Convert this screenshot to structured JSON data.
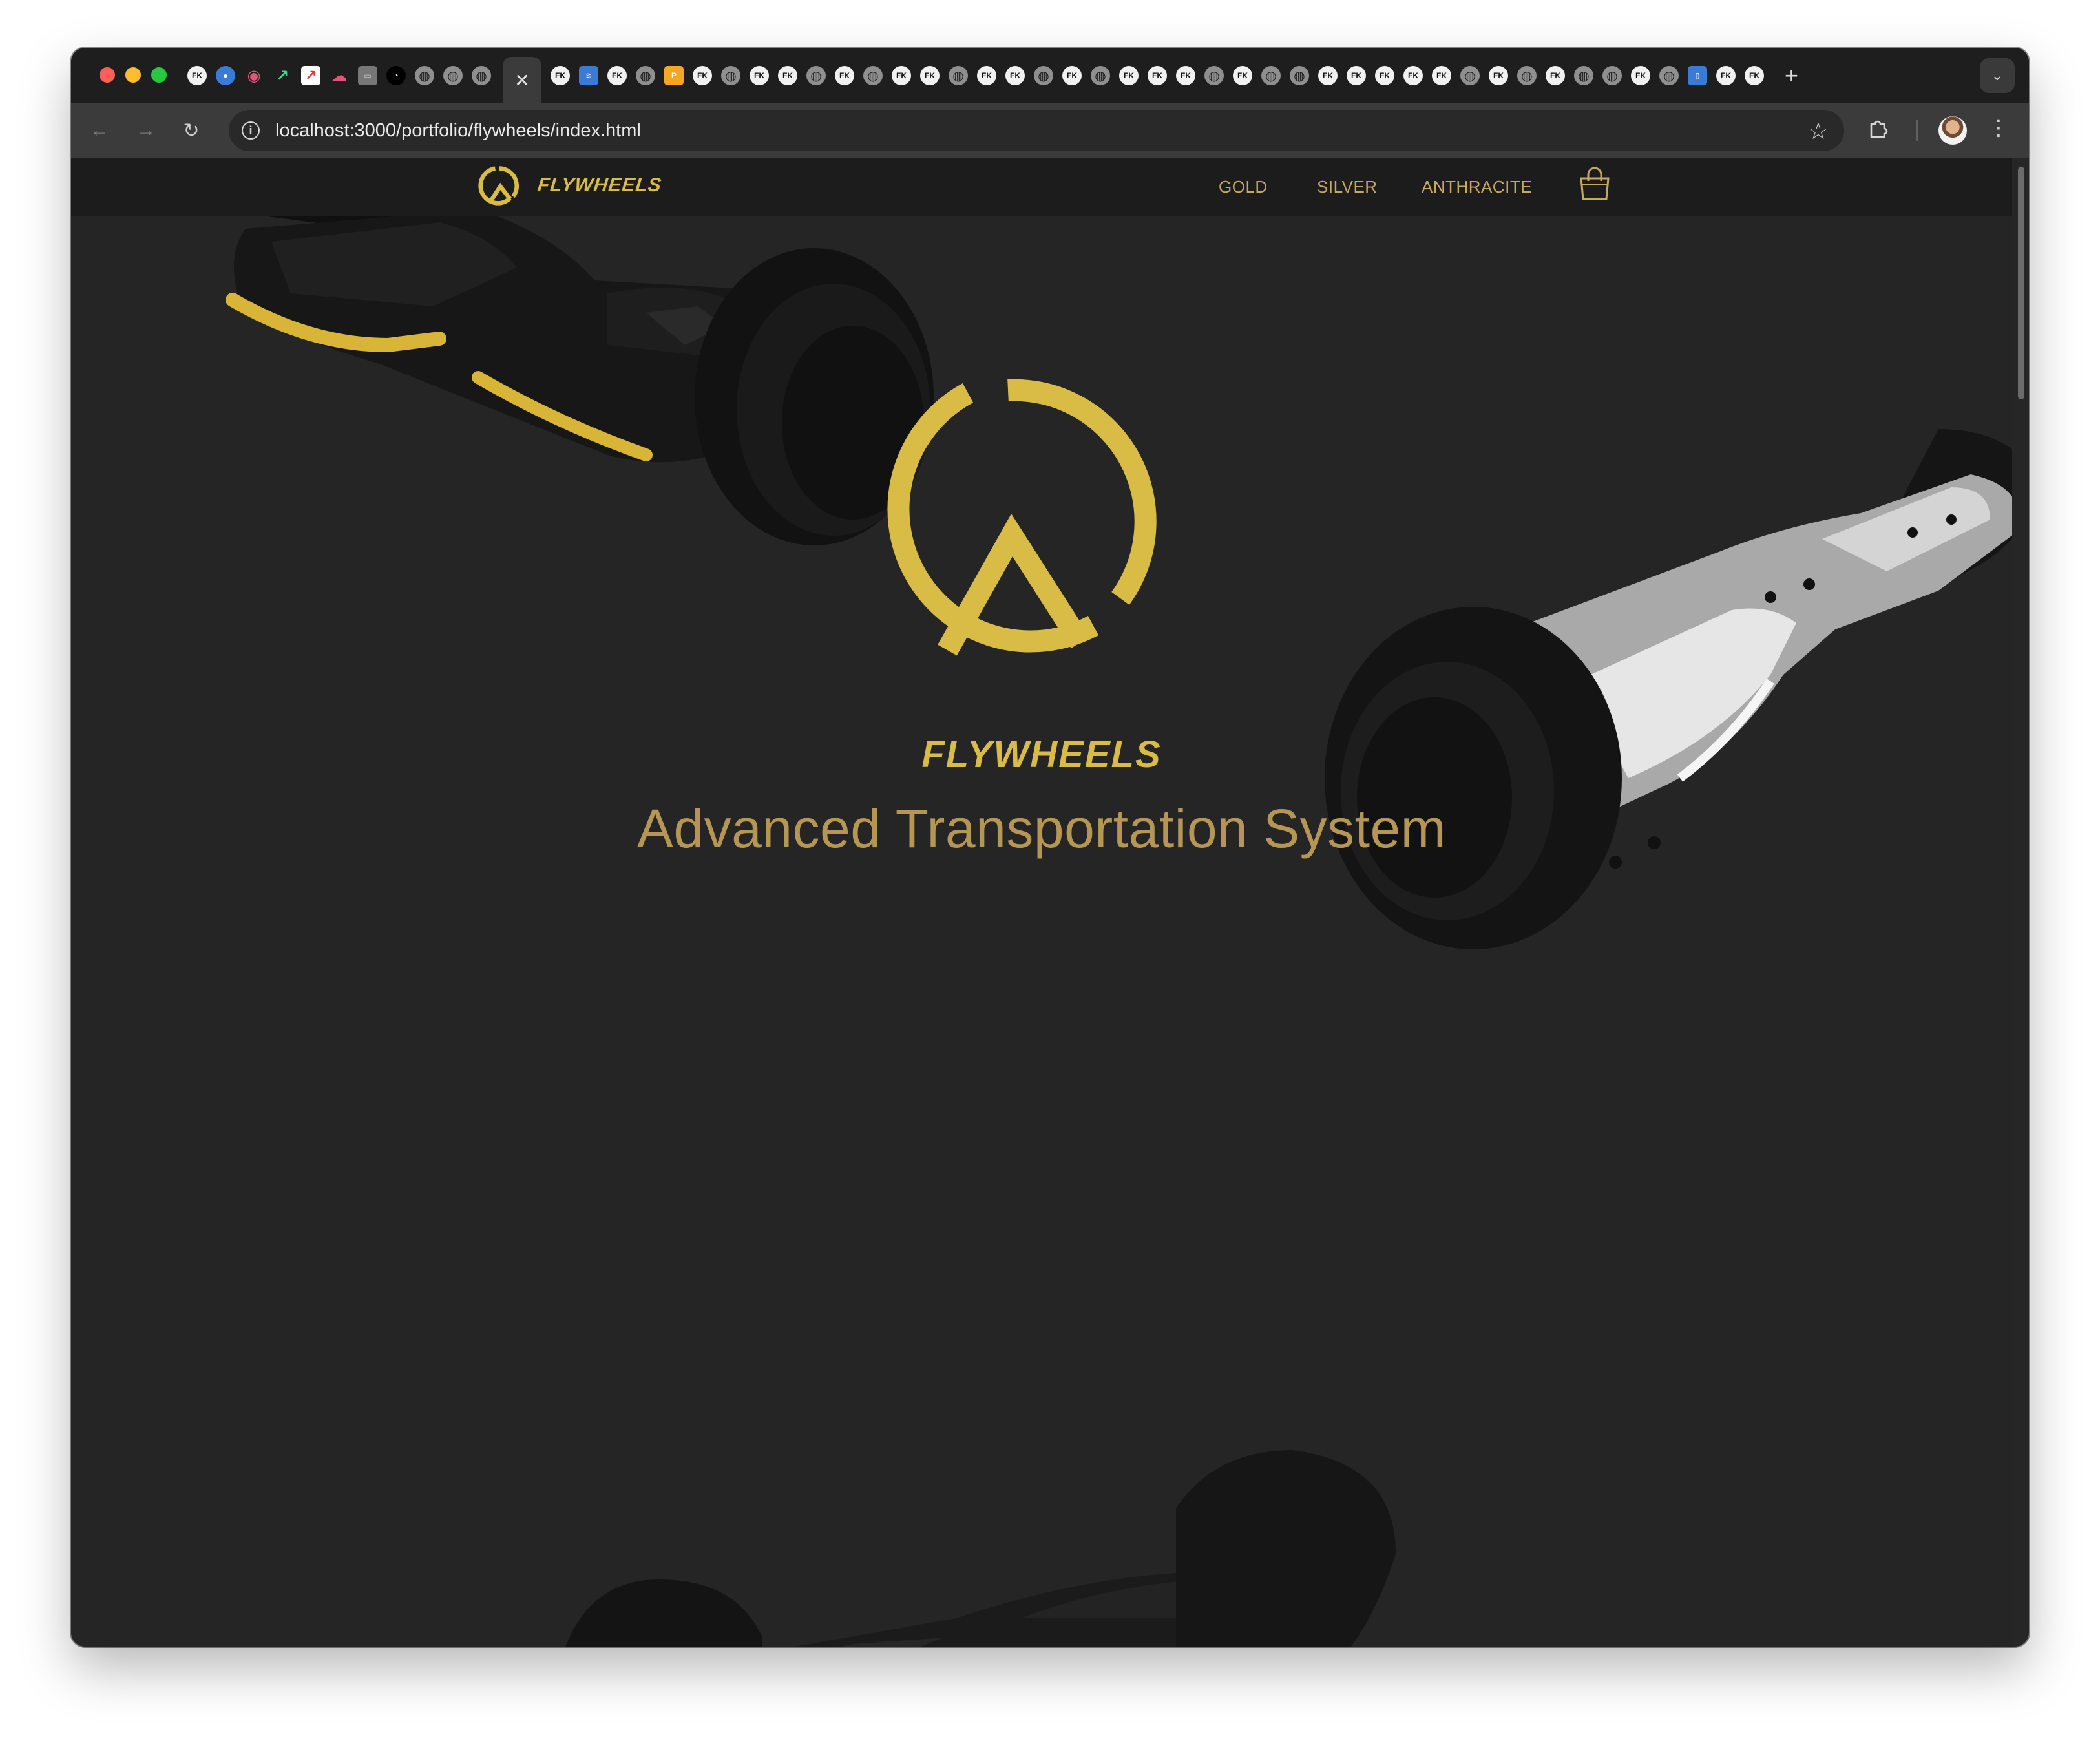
{
  "browser": {
    "active_tab_close": "✕",
    "new_tab": "+",
    "tab_menu": "⌄",
    "favicon_fk": "FK",
    "favicon_globe": "◍",
    "url": "localhost:3000/portfolio/flywheels/index.html",
    "omnibox_info": "i",
    "back": "←",
    "forward": "→",
    "reload": "↻",
    "bookmark": "☆",
    "menu": "⋮"
  },
  "site": {
    "brand": "FLYWHEELS",
    "nav": {
      "gold": "GOLD",
      "silver": "SILVER",
      "anthracite": "ANTHRACITE"
    },
    "hero": {
      "brand": "FLYWHEELS",
      "tagline": "Advanced Transportation System"
    }
  },
  "colors": {
    "page_background": "#252525",
    "nav_background": "#1c1c1c",
    "brand_gold": "#d8bc46",
    "nav_link": "#c9a862",
    "tagline": "#b69654"
  },
  "icons": {
    "logo": "circle-peak-logo-icon",
    "cart": "shopping-bag-icon",
    "extensions": "puzzle-icon",
    "profile": "avatar"
  }
}
